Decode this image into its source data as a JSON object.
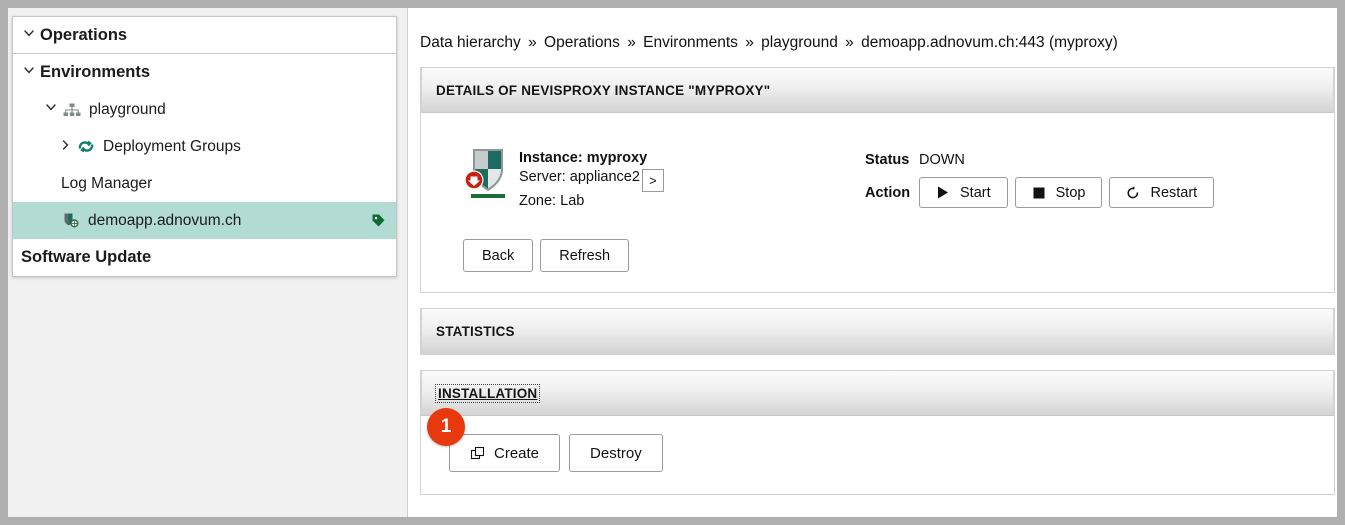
{
  "sidebar": {
    "items": [
      {
        "label": "Operations",
        "icon": "chevron-down-icon",
        "level": 0,
        "bold": true
      },
      {
        "label": "Environments",
        "icon": "chevron-down-icon",
        "level": 0,
        "bold": true
      },
      {
        "label": "playground",
        "icon": "sitemap-icon",
        "level": 1,
        "bold": false
      },
      {
        "label": "Deployment Groups",
        "icon": "deployment-group-icon",
        "level": 2,
        "bold": false
      },
      {
        "label": "Log Manager",
        "icon": "none",
        "level": 2,
        "bold": false
      },
      {
        "label": "demoapp.adnovum.ch",
        "icon": "proxy-globe-icon",
        "level": 3,
        "bold": false,
        "selected": true,
        "trailing_icon": "tag-icon"
      },
      {
        "label": "Software Update",
        "icon": "none",
        "level": 0,
        "bold": true
      }
    ]
  },
  "breadcrumb": {
    "separator": "»",
    "crumbs": [
      "Data hierarchy",
      "Operations",
      "Environments",
      "playground",
      "demoapp.adnovum.ch:443 (myproxy)"
    ]
  },
  "details_panel": {
    "title": "DETAILS OF NEVISPROXY INSTANCE \"MYPROXY\"",
    "instance": {
      "icon": "shield-down-icon",
      "instance_label": "Instance:",
      "instance_value": "myproxy",
      "server_label": "Server:",
      "server_value": "appliance2",
      "server_more_button": ">",
      "zone_label": "Zone:",
      "zone_value": "Lab"
    },
    "status": {
      "label": "Status",
      "value": "DOWN",
      "action_label": "Action",
      "actions": [
        {
          "label": "Start",
          "icon": "play-icon"
        },
        {
          "label": "Stop",
          "icon": "stop-icon"
        },
        {
          "label": "Restart",
          "icon": "restart-icon"
        }
      ]
    },
    "footer_buttons": [
      {
        "label": "Back"
      },
      {
        "label": "Refresh"
      }
    ]
  },
  "statistics_panel": {
    "title": "STATISTICS"
  },
  "installation_panel": {
    "title": "INSTALLATION",
    "badge": "1",
    "buttons": [
      {
        "label": "Create",
        "icon": "copy-windows-icon"
      },
      {
        "label": "Destroy",
        "icon": "none"
      }
    ]
  },
  "colors": {
    "selection": "#b2dbd4",
    "badge": "#e8380d",
    "accent_teal": "#107d71",
    "status_down": "#111111"
  }
}
